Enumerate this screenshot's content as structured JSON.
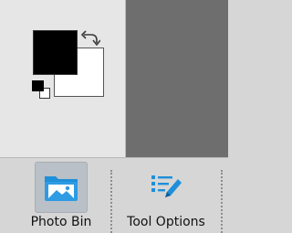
{
  "colors": {
    "foreground": "#000000",
    "background": "#ffffff",
    "panel": "#e6e6e6",
    "canvas": "#6e6e6e",
    "taskbar": "#d6d6d6",
    "icon_blue": "#1f8fd9"
  },
  "color_picker": {
    "swap_icon": "swap-colors-icon",
    "default_icon": "default-colors-icon"
  },
  "taskbar": {
    "photo_bin": {
      "label": "Photo Bin",
      "icon": "photo-bin-icon",
      "active": true
    },
    "tool_options": {
      "label": "Tool Options",
      "icon": "tool-options-icon",
      "active": false
    }
  }
}
